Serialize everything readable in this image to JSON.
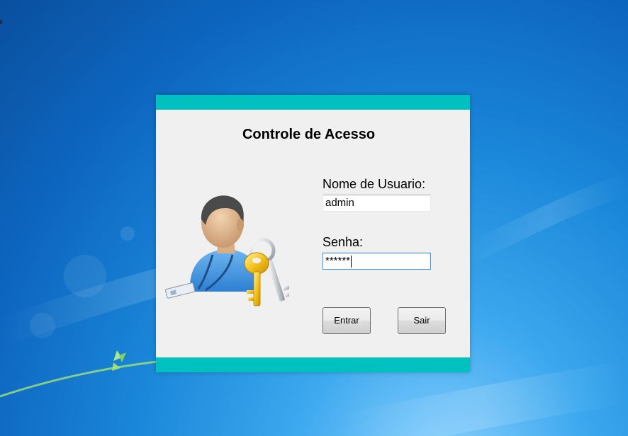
{
  "window": {
    "title": "Controle de Acesso",
    "accent_color": "#00c0c0",
    "illustration": "user-with-keys-icon"
  },
  "form": {
    "username_label": "Nome de Usuario:",
    "username_value": "admin",
    "password_label": "Senha:",
    "password_value": "******"
  },
  "buttons": {
    "enter_label": "Entrar",
    "exit_label": "Sair"
  }
}
